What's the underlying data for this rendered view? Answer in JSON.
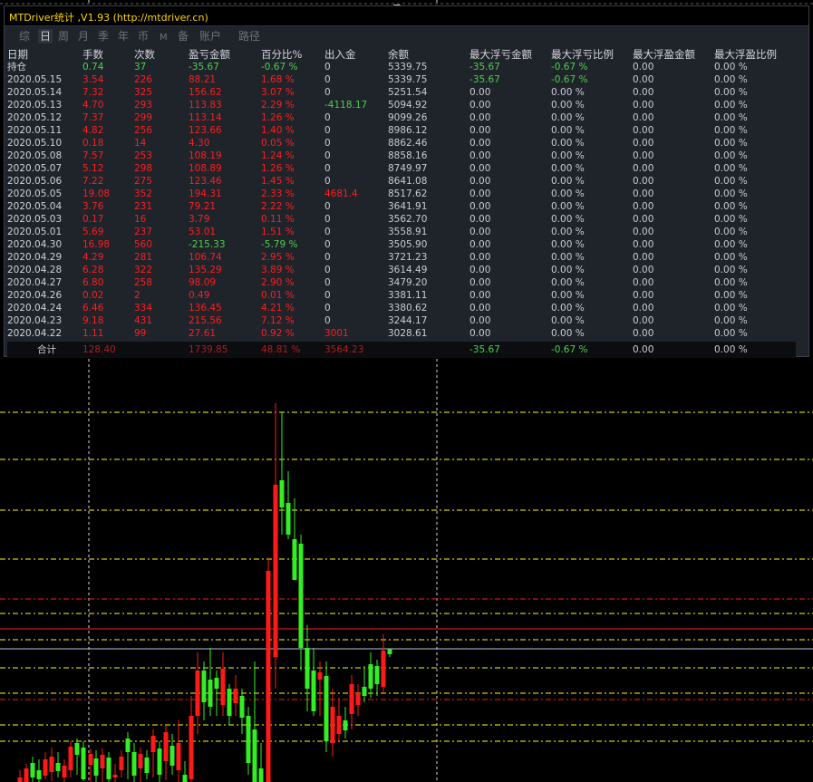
{
  "title": "MTDriver统计 ,V1.93 (http://mtdriver.cn)",
  "tabs": [
    "综",
    "日",
    "周",
    "月",
    "季",
    "年",
    "币",
    "M",
    "备",
    "账户",
    "路径"
  ],
  "active_tab": "日",
  "headers": [
    "日期",
    "手数",
    "次数",
    "盈亏金额",
    "百分比%",
    "出入金",
    "余额",
    "最大浮亏金额",
    "最大浮亏比例",
    "最大浮盈金额",
    "最大浮盈比例"
  ],
  "rows": [
    [
      "持仓",
      "0.74",
      "37",
      "-35.67",
      "-0.67 %",
      "0",
      "5339.75",
      "-35.67",
      "-0.67 %",
      "0.00",
      "0.00 %"
    ],
    [
      "2020.05.15",
      "3.54",
      "226",
      "88.21",
      "1.68 %",
      "0",
      "5339.75",
      "-35.67",
      "-0.67 %",
      "0.00",
      "0.00 %"
    ],
    [
      "2020.05.14",
      "7.32",
      "325",
      "156.62",
      "3.07 %",
      "0",
      "5251.54",
      "0.00",
      "0.00 %",
      "0.00",
      "0.00 %"
    ],
    [
      "2020.05.13",
      "4.70",
      "293",
      "113.83",
      "2.29 %",
      "-4118.17",
      "5094.92",
      "0.00",
      "0.00 %",
      "0.00",
      "0.00 %"
    ],
    [
      "2020.05.12",
      "7.37",
      "299",
      "113.14",
      "1.26 %",
      "0",
      "9099.26",
      "0.00",
      "0.00 %",
      "0.00",
      "0.00 %"
    ],
    [
      "2020.05.11",
      "4.82",
      "256",
      "123.66",
      "1.40 %",
      "0",
      "8986.12",
      "0.00",
      "0.00 %",
      "0.00",
      "0.00 %"
    ],
    [
      "2020.05.10",
      "0.18",
      "14",
      "4.30",
      "0.05 %",
      "0",
      "8862.46",
      "0.00",
      "0.00 %",
      "0.00",
      "0.00 %"
    ],
    [
      "2020.05.08",
      "7.57",
      "253",
      "108.19",
      "1.24 %",
      "0",
      "8858.16",
      "0.00",
      "0.00 %",
      "0.00",
      "0.00 %"
    ],
    [
      "2020.05.07",
      "5.12",
      "298",
      "108.89",
      "1.26 %",
      "0",
      "8749.97",
      "0.00",
      "0.00 %",
      "0.00",
      "0.00 %"
    ],
    [
      "2020.05.06",
      "7.22",
      "275",
      "123.46",
      "1.45 %",
      "0",
      "8641.08",
      "0.00",
      "0.00 %",
      "0.00",
      "0.00 %"
    ],
    [
      "2020.05.05",
      "19.08",
      "352",
      "194.31",
      "2.33 %",
      "4681.4",
      "8517.62",
      "0.00",
      "0.00 %",
      "0.00",
      "0.00 %"
    ],
    [
      "2020.05.04",
      "3.76",
      "231",
      "79.21",
      "2.22 %",
      "0",
      "3641.91",
      "0.00",
      "0.00 %",
      "0.00",
      "0.00 %"
    ],
    [
      "2020.05.03",
      "0.17",
      "16",
      "3.79",
      "0.11 %",
      "0",
      "3562.70",
      "0.00",
      "0.00 %",
      "0.00",
      "0.00 %"
    ],
    [
      "2020.05.01",
      "5.69",
      "237",
      "53.01",
      "1.51 %",
      "0",
      "3558.91",
      "0.00",
      "0.00 %",
      "0.00",
      "0.00 %"
    ],
    [
      "2020.04.30",
      "16.98",
      "560",
      "-215.33",
      "-5.79 %",
      "0",
      "3505.90",
      "0.00",
      "0.00 %",
      "0.00",
      "0.00 %"
    ],
    [
      "2020.04.29",
      "4.29",
      "281",
      "106.74",
      "2.95 %",
      "0",
      "3721.23",
      "0.00",
      "0.00 %",
      "0.00",
      "0.00 %"
    ],
    [
      "2020.04.28",
      "6.28",
      "322",
      "135.29",
      "3.89 %",
      "0",
      "3614.49",
      "0.00",
      "0.00 %",
      "0.00",
      "0.00 %"
    ],
    [
      "2020.04.27",
      "6.80",
      "258",
      "98.09",
      "2.90 %",
      "0",
      "3479.20",
      "0.00",
      "0.00 %",
      "0.00",
      "0.00 %"
    ],
    [
      "2020.04.26",
      "0.02",
      "2",
      "0.49",
      "0.01 %",
      "0",
      "3381.11",
      "0.00",
      "0.00 %",
      "0.00",
      "0.00 %"
    ],
    [
      "2020.04.24",
      "6.46",
      "334",
      "136.45",
      "4.21 %",
      "0",
      "3380.62",
      "0.00",
      "0.00 %",
      "0.00",
      "0.00 %"
    ],
    [
      "2020.04.23",
      "9.18",
      "431",
      "215.56",
      "7.12 %",
      "0",
      "3244.17",
      "0.00",
      "0.00 %",
      "0.00",
      "0.00 %"
    ],
    [
      "2020.04.22",
      "1.11",
      "99",
      "27.61",
      "0.92 %",
      "3001",
      "3028.61",
      "0.00",
      "0.00 %",
      "0.00",
      "0.00 %"
    ]
  ],
  "total": [
    "合计",
    "128.40",
    "",
    "1739.85",
    "48.81 %",
    "3564.23",
    "",
    "-35.67",
    "-0.67 %",
    "0.00",
    "0.00 %"
  ],
  "colors": {
    "background": "#000000",
    "panel": "#1f232a",
    "title_text": "#ffd800",
    "profit": "#ff1e1e",
    "loss": "#4cd04c",
    "bull_candle": "#33ee22",
    "bear_candle": "#ff1a1a",
    "grid_white": "#d8d8d8",
    "level_yellow": "#ffff00",
    "level_red": "#ff1a1a"
  }
}
